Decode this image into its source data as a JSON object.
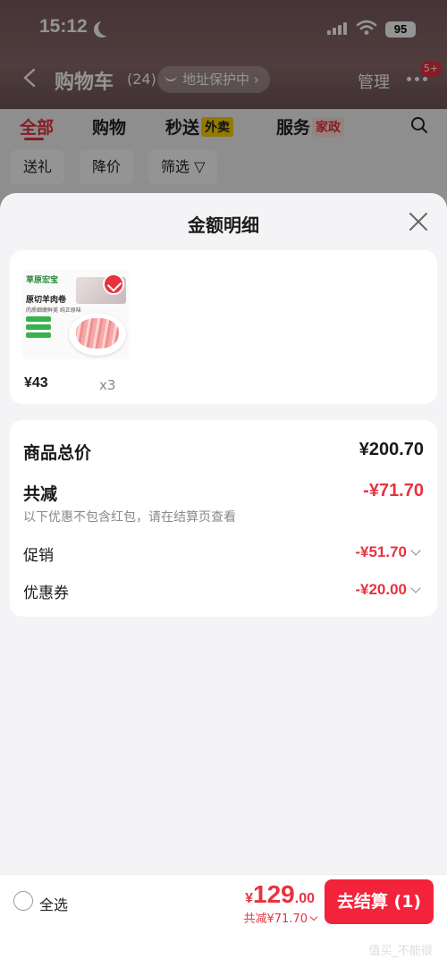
{
  "status_bar": {
    "time": "15:12",
    "battery": "95"
  },
  "nav": {
    "title": "购物车",
    "count": "(24)",
    "address_protection": "地址保护中",
    "manage": "管理",
    "message_badge": "5+"
  },
  "tabs": [
    {
      "label": "全部",
      "tag": ""
    },
    {
      "label": "购物",
      "tag": ""
    },
    {
      "label": "秒送",
      "tag": "外卖"
    },
    {
      "label": "服务",
      "tag": "家政"
    }
  ],
  "filters": [
    "送礼",
    "降价",
    "筛选"
  ],
  "sheet": {
    "title": "金额明细",
    "product": {
      "brand": "草原宏宝",
      "package_name": "原切羊肉卷",
      "package_sub": "肉质细嫩鲜美 纯正原味",
      "price": "¥43",
      "quantity": "x3"
    },
    "summary": {
      "goods_total_label": "商品总价",
      "goods_total_value": "¥200.70",
      "total_discount_label": "共减",
      "total_discount_value": "-¥71.70",
      "note": "以下优惠不包含红包，请在结算页查看",
      "promotion_label": "促销",
      "promotion_value": "-¥51.70",
      "coupon_label": "优惠券",
      "coupon_value": "-¥20.00"
    }
  },
  "bottom_bar": {
    "select_all": "全选",
    "currency": "¥",
    "total_int": "129",
    "total_dec": ".00",
    "discount": "共减¥71.70",
    "checkout": "去结算 (1)",
    "watermark": "值买_不能很"
  },
  "colors": {
    "accent": "#e7333f",
    "checkout": "#f3233b"
  }
}
